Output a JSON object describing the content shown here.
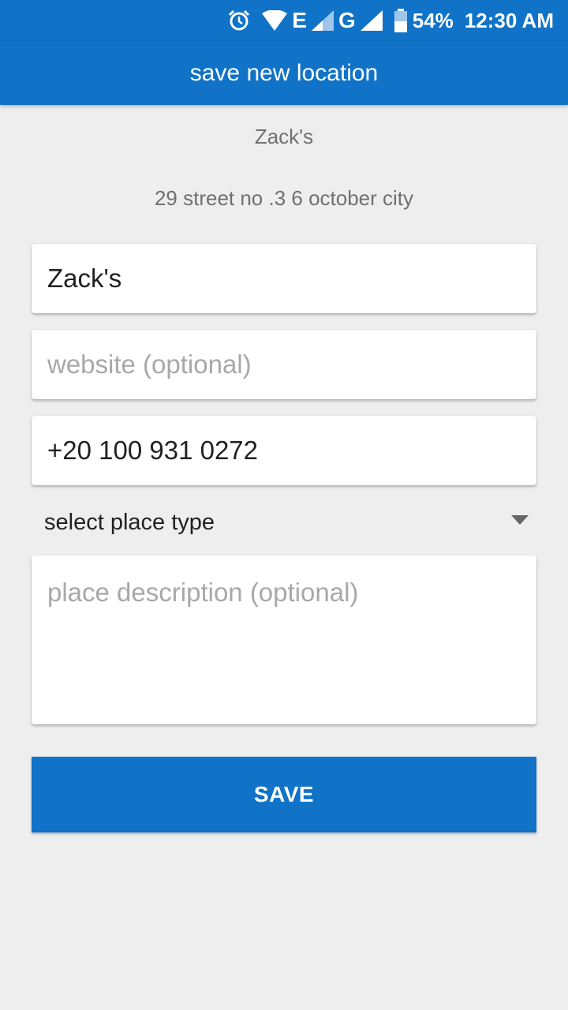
{
  "status_bar": {
    "battery": "54%",
    "time": "12:30 AM",
    "network_1": "E",
    "network_2": "G"
  },
  "app_bar": {
    "title": "save new location"
  },
  "place": {
    "name": "Zack's",
    "address": "29 street no .3 6 october city"
  },
  "form": {
    "name_value": "Zack's",
    "website_placeholder": "website (optional)",
    "phone_value": "+20 100 931 0272",
    "place_type_label": "select place type",
    "description_placeholder": "place description (optional)",
    "save_label": "SAVE"
  },
  "colors": {
    "primary": "#1073c7",
    "background": "#eeeeee"
  }
}
